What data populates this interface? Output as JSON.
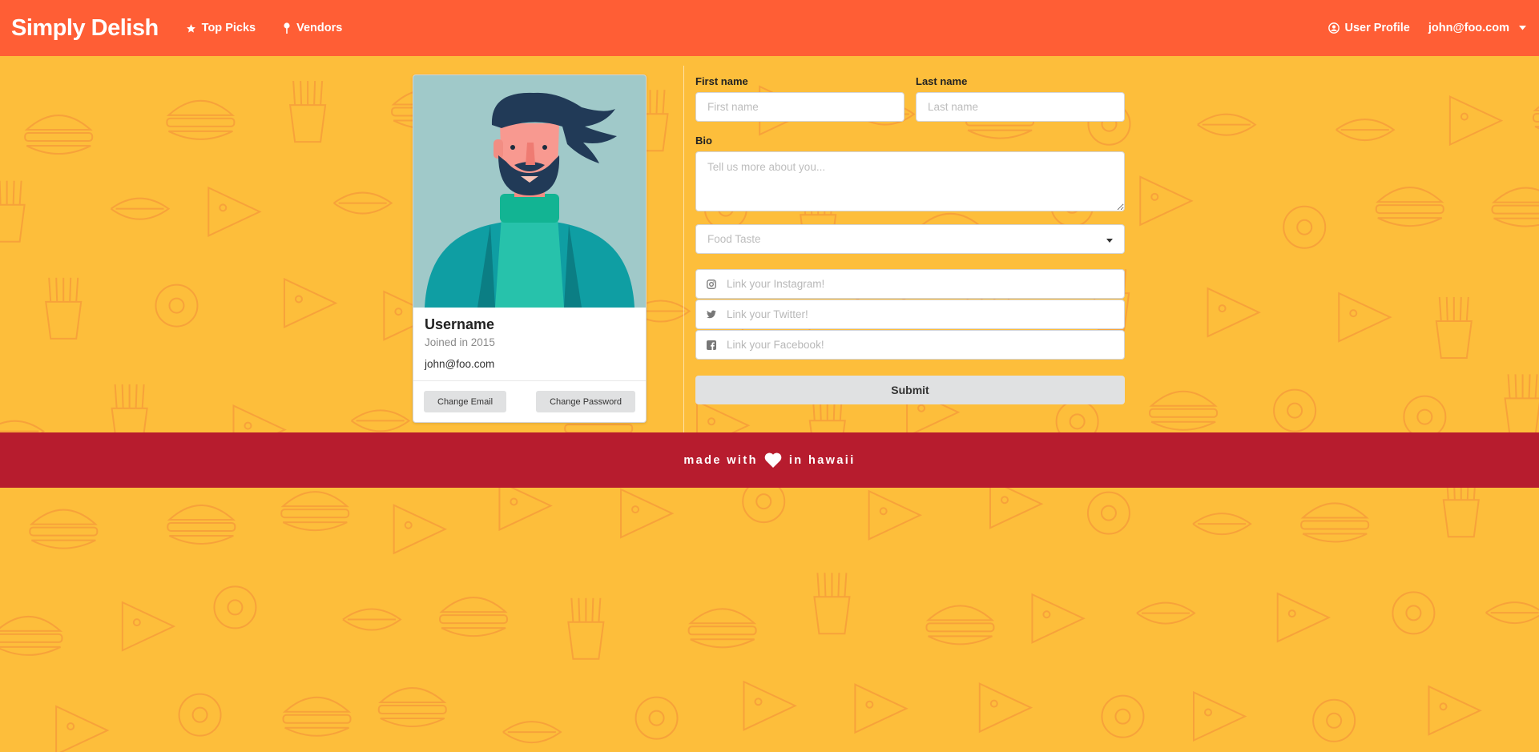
{
  "navbar": {
    "brand": "Simply Delish",
    "items": [
      {
        "label": "Top Picks",
        "icon": "star-icon"
      },
      {
        "label": "Vendors",
        "icon": "map-pin-icon"
      }
    ],
    "profile_label": "User Profile",
    "profile_icon": "user-circle-icon",
    "user_email": "john@foo.com",
    "dropdown_icon": "caret-down-icon"
  },
  "profile_card": {
    "username": "Username",
    "joined": "Joined in 2015",
    "email": "john@foo.com",
    "change_email_label": "Change Email",
    "change_password_label": "Change Password"
  },
  "form": {
    "first_name_label": "First name",
    "first_name_placeholder": "First name",
    "last_name_label": "Last name",
    "last_name_placeholder": "Last name",
    "bio_label": "Bio",
    "bio_placeholder": "Tell us more about you...",
    "food_taste_placeholder": "Food Taste",
    "instagram_placeholder": "Link your Instagram!",
    "twitter_placeholder": "Link your Twitter!",
    "facebook_placeholder": "Link your Facebook!",
    "submit_label": "Submit"
  },
  "footer": {
    "text_before": "made with",
    "text_after": "in hawaii",
    "icon": "heart-icon"
  },
  "colors": {
    "navbar": "#ff5e35",
    "background": "#fdbe3b",
    "footer": "#b71c2e"
  }
}
